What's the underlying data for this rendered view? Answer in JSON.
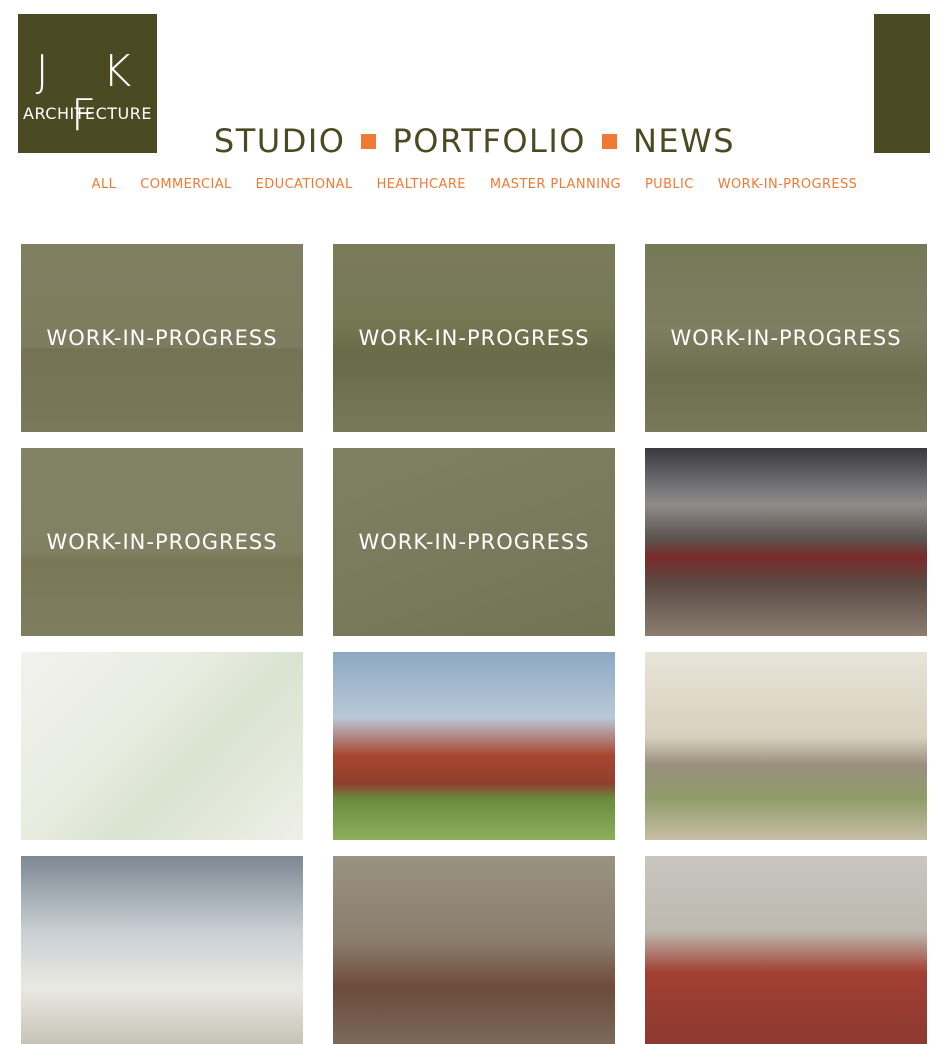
{
  "logo": {
    "letters": "J K F",
    "word": "ARCHITECTURE"
  },
  "main_nav": [
    "STUDIO",
    "PORTFOLIO",
    "NEWS"
  ],
  "filters": [
    "ALL",
    "COMMERCIAL",
    "EDUCATIONAL",
    "HEALTHCARE",
    "MASTER PLANNING",
    "PUBLIC",
    "WORK-IN-PROGRESS"
  ],
  "tiles": [
    {
      "label": "WORK-IN-PROGRESS"
    },
    {
      "label": "WORK-IN-PROGRESS"
    },
    {
      "label": "WORK-IN-PROGRESS"
    },
    {
      "label": "WORK-IN-PROGRESS"
    },
    {
      "label": "WORK-IN-PROGRESS"
    }
  ],
  "colors": {
    "brand": "#4b4a22",
    "accent": "#f07a35"
  }
}
